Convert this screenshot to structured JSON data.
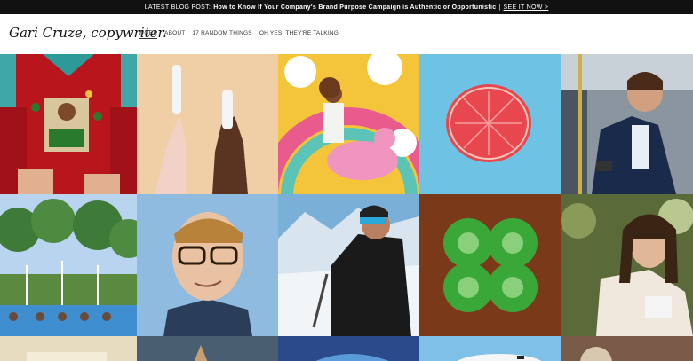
{
  "announcement": {
    "prefix": "LATEST BLOG POST:",
    "post_title": "How to Know If Your Company's Brand Purpose Campaign is Authentic or Opportunistic",
    "separator": "|",
    "link_label": "SEE IT NOW >"
  },
  "header": {
    "logo": "Gari Cruze, copywriter.",
    "nav": [
      {
        "label": "WORK",
        "active": true
      },
      {
        "label": "ABOUT",
        "active": false
      },
      {
        "label": "17 RANDOM THINGS",
        "active": false
      },
      {
        "label": "OH YES, THEY'RE TALKING",
        "active": false
      }
    ]
  },
  "portfolio": {
    "tiles": [
      {
        "subject": "ugly-christmas-sweater"
      },
      {
        "subject": "hands-holding-tampons"
      },
      {
        "subject": "woman-on-unicorn-carousel"
      },
      {
        "subject": "grapefruit-half"
      },
      {
        "subject": "man-on-train-with-phone"
      },
      {
        "subject": "pool-fountains-swimmers"
      },
      {
        "subject": "man-with-glasses-smirking"
      },
      {
        "subject": "snowboarder-mountains"
      },
      {
        "subject": "four-leaf-clover"
      },
      {
        "subject": "woman-in-cafe"
      },
      {
        "subject": "bottom-row-1"
      },
      {
        "subject": "bottom-row-2"
      },
      {
        "subject": "bottom-row-3"
      },
      {
        "subject": "airplane"
      },
      {
        "subject": "bottom-row-5"
      }
    ]
  },
  "colors": {
    "announce_bg": "#111111",
    "sweater_red": "#b8151c",
    "peach": "#f0cfa6",
    "sky_blue": "#6ec3e4",
    "grapefruit": "#e8474f"
  }
}
